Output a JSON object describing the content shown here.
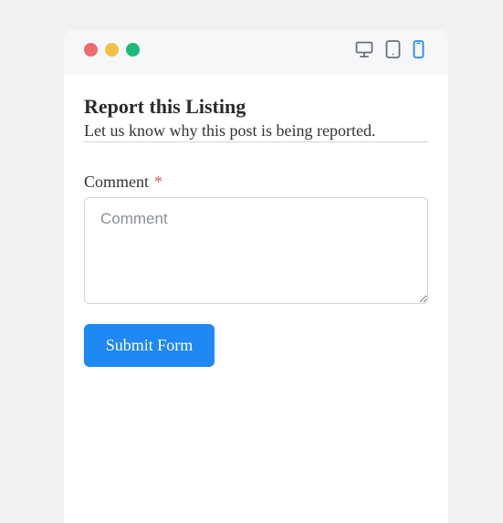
{
  "window": {
    "controls": {
      "close_color": "#ec6b72",
      "minimize_color": "#f5c144",
      "maximize_color": "#1db97a"
    },
    "device_toggle": {
      "items": [
        {
          "name": "desktop-icon",
          "selected": false
        },
        {
          "name": "tablet-icon",
          "selected": false
        },
        {
          "name": "mobile-icon",
          "selected": true
        }
      ],
      "inactive_color": "#6b6f75",
      "active_color": "#1e88f5"
    }
  },
  "form": {
    "title": "Report this Listing",
    "subtitle": "Let us know why this post is being reported.",
    "comment": {
      "label": "Comment",
      "required_marker": "*",
      "placeholder": "Comment",
      "value": ""
    },
    "submit_label": "Submit Form",
    "accent_color": "#1e88f5"
  }
}
